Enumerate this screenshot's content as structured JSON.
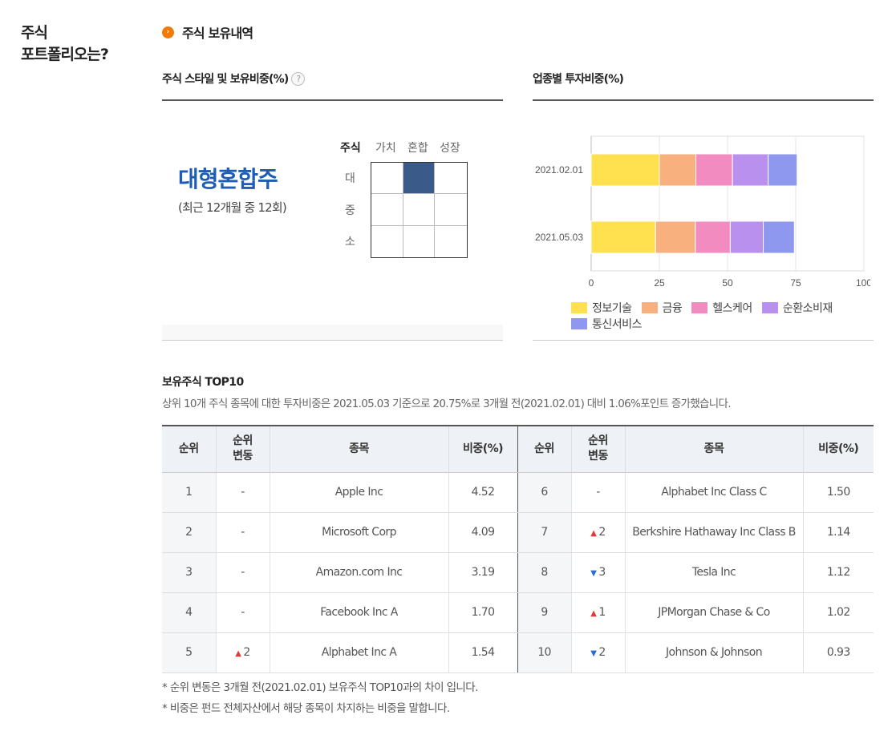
{
  "sidebar": {
    "title_line1": "주식",
    "title_line2": "포트폴리오는?"
  },
  "section": {
    "title": "주식 보유내역",
    "bullet": "›"
  },
  "style_box": {
    "header": "주식 스타일 및 보유비중(%)",
    "help_icon": "?",
    "style_name": "대형혼합주",
    "style_sub": "(최근 12개월 중 12회)",
    "grid_label": "주식",
    "columns": [
      "가치",
      "혼합",
      "성장"
    ],
    "rows": [
      "대",
      "중",
      "소"
    ],
    "active_cell": {
      "row": 0,
      "col": 1
    }
  },
  "sector_box": {
    "header": "업종별 투자비중(%)"
  },
  "chart_data": {
    "type": "bar",
    "orientation": "horizontal",
    "stacked": true,
    "categories": [
      "2021.02.01",
      "2021.05.03"
    ],
    "series": [
      {
        "name": "정보기술",
        "color": "#ffe04f",
        "values": [
          25.0,
          23.6
        ]
      },
      {
        "name": "금융",
        "color": "#f8b07e",
        "values": [
          13.4,
          14.6
        ]
      },
      {
        "name": "헬스케어",
        "color": "#f28cc0",
        "values": [
          13.4,
          12.8
        ]
      },
      {
        "name": "순환소비재",
        "color": "#b990ee",
        "values": [
          13.1,
          12.1
        ]
      },
      {
        "name": "통신서비스",
        "color": "#8e98ee",
        "values": [
          10.6,
          11.4
        ]
      }
    ],
    "xlim": [
      0,
      100
    ],
    "xticks": [
      0,
      25,
      50,
      75,
      100
    ],
    "grid": true,
    "legend": "bottom"
  },
  "top10": {
    "title": "보유주식 TOP10",
    "desc": "상위 10개 주식 종목에 대한 투자비중은 2021.05.03 기준으로 20.75%로 3개월 전(2021.02.01) 대비 1.06%포인트 증가했습니다.",
    "headers": {
      "rank": "순위",
      "change_1": "순위",
      "change_2": "변동",
      "name": "종목",
      "weight": "비중(%)"
    },
    "rows": [
      {
        "left": {
          "rank": "1",
          "dir": "",
          "chg": "-",
          "name": "Apple Inc",
          "weight": "4.52"
        },
        "right": {
          "rank": "6",
          "dir": "",
          "chg": "-",
          "name": "Alphabet Inc Class C",
          "weight": "1.50"
        }
      },
      {
        "left": {
          "rank": "2",
          "dir": "",
          "chg": "-",
          "name": "Microsoft Corp",
          "weight": "4.09"
        },
        "right": {
          "rank": "7",
          "dir": "up",
          "chg": "2",
          "name": "Berkshire Hathaway Inc Class B",
          "weight": "1.14"
        }
      },
      {
        "left": {
          "rank": "3",
          "dir": "",
          "chg": "-",
          "name": "Amazon.com Inc",
          "weight": "3.19"
        },
        "right": {
          "rank": "8",
          "dir": "down",
          "chg": "3",
          "name": "Tesla Inc",
          "weight": "1.12"
        }
      },
      {
        "left": {
          "rank": "4",
          "dir": "",
          "chg": "-",
          "name": "Facebook Inc A",
          "weight": "1.70"
        },
        "right": {
          "rank": "9",
          "dir": "up",
          "chg": "1",
          "name": "JPMorgan Chase & Co",
          "weight": "1.02"
        }
      },
      {
        "left": {
          "rank": "5",
          "dir": "up",
          "chg": "2",
          "name": "Alphabet Inc A",
          "weight": "1.54"
        },
        "right": {
          "rank": "10",
          "dir": "down",
          "chg": "2",
          "name": "Johnson & Johnson",
          "weight": "0.93"
        }
      }
    ],
    "notes": [
      "* 순위 변동은 3개월 전(2021.02.01) 보유주식 TOP10과의 차이 입니다.",
      "* 비중은 펀드 전체자산에서 해당 종목이 차지하는 비중을 말합니다."
    ]
  },
  "colors": {
    "accent": "#f27b06",
    "style_text": "#1e5db4",
    "active_cell": "#3a5a8a",
    "up": "#e03a3a",
    "down": "#2b6cd6"
  }
}
